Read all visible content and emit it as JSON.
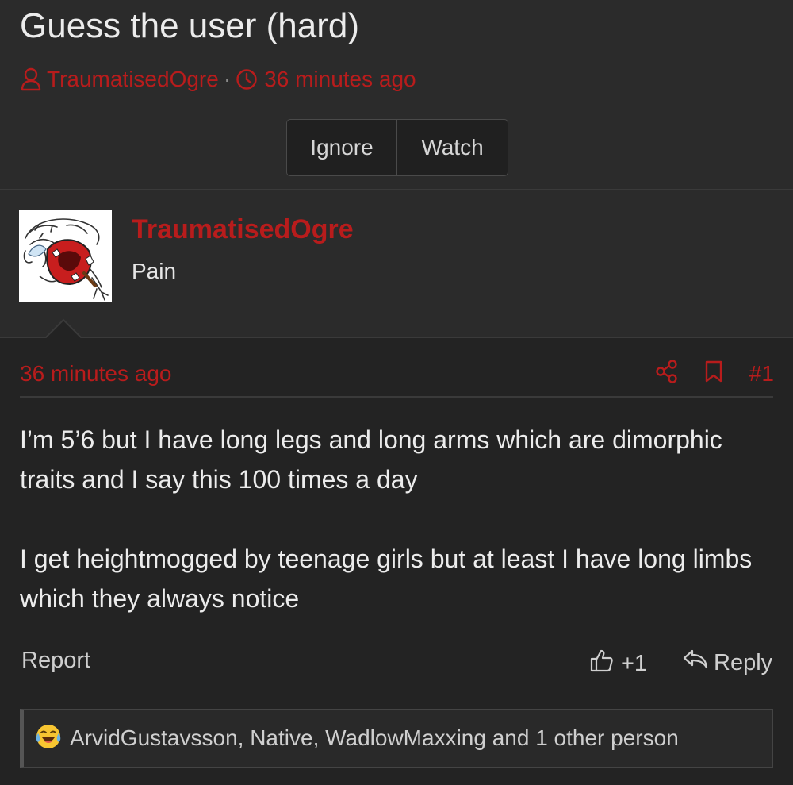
{
  "thread": {
    "title": "Guess the user (hard)",
    "author": "TraumatisedOgre",
    "separator": "·",
    "time": "36 minutes ago",
    "buttons": {
      "ignore": "Ignore",
      "watch": "Watch"
    }
  },
  "user": {
    "name": "TraumatisedOgre",
    "title": "Pain"
  },
  "post": {
    "time": "36 minutes ago",
    "number": "#1",
    "paragraphs": [
      "I’m 5’6 but I have long legs and long arms which are dimorphic traits and I say this 100 times a day",
      "I get heightmogged by teenage girls but at least I have long limbs which they always notice"
    ],
    "report_label": "Report",
    "like_count": "+1",
    "reply_label": "Reply",
    "reactions_text": "ArvidGustavsson, Native, WadlowMaxxing and 1 other person"
  },
  "colors": {
    "accent": "#b81c1c",
    "background": "#262626",
    "post_background": "#232323"
  },
  "icons": {
    "author": "user-icon",
    "time": "clock-icon",
    "share": "share-icon",
    "bookmark": "bookmark-icon",
    "like": "thumbs-up-icon",
    "reply": "reply-icon",
    "reaction": "laughing-crying-emoji-icon"
  }
}
